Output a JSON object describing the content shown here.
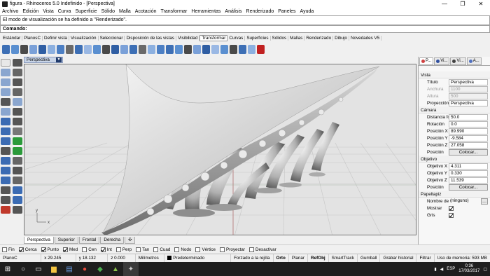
{
  "window": {
    "title": "figura - Rhinoceros 5.0 Indefinido - [Perspectiva]",
    "controls": [
      "—",
      "❐",
      "✕"
    ]
  },
  "menu": [
    "Archivo",
    "Edición",
    "Vista",
    "Curva",
    "Superficie",
    "Sólido",
    "Malla",
    "Acotación",
    "Transformar",
    "Herramientas",
    "Análisis",
    "Renderizado",
    "Paneles",
    "Ayuda"
  ],
  "command": {
    "history": "El modo de visualización se ha definido a \"Renderizado\".",
    "prompt": "Comando:"
  },
  "toolbar_tabs": [
    "Estándar",
    "PlanosC",
    "Definir vista",
    "Visualización",
    "Seleccionar",
    "Disposición de las vistas",
    "Visibilidad",
    "Transformar",
    "Curvas",
    "Superficies",
    "Sólidos",
    "Mallas",
    "Renderizado",
    "Dibujo",
    "Novedades V5"
  ],
  "active_toolbar_tab": "Transformar",
  "viewport": {
    "label": "Perspectiva",
    "axis_y": "y",
    "axis_x": "x"
  },
  "viewport_tabs": [
    "Perspectiva",
    "Superior",
    "Frontal",
    "Derecha"
  ],
  "active_viewport_tab": "Perspectiva",
  "osnaps": [
    {
      "label": "Fin",
      "on": false
    },
    {
      "label": "Cerca",
      "on": true
    },
    {
      "label": "Punto",
      "on": true
    },
    {
      "label": "Med",
      "on": true
    },
    {
      "label": "Cen",
      "on": false
    },
    {
      "label": "Int",
      "on": true
    },
    {
      "label": "Perp",
      "on": false
    },
    {
      "label": "Tan",
      "on": false
    },
    {
      "label": "Cuad",
      "on": false
    },
    {
      "label": "Nodo",
      "on": false
    },
    {
      "label": "Vértice",
      "on": false
    },
    {
      "label": "Proyectar",
      "on": false
    },
    {
      "label": "Desactivar",
      "on": false
    }
  ],
  "status": {
    "cplane": "PlanoC",
    "x": "x 29.245",
    "y": "y 18.132",
    "z": "z 0.000",
    "units": "Milímetros",
    "layer": "Predeterminado",
    "snap": "Forzado a la rejilla",
    "ortho": "Orto",
    "planar": "Planar",
    "osnap": "RefObj",
    "smarttrack": "SmartTrack",
    "gumball": "Gumball",
    "history": "Grabar historial",
    "filter": "Filtrar",
    "memory": "Uso de memoria: 593 MB"
  },
  "panel": {
    "tabs": [
      "P...",
      "Vi...",
      "Vi...",
      "A..."
    ],
    "tab_colors": [
      "#d04040",
      "#3050a0",
      "#404040",
      "#5070c0"
    ],
    "sections": {
      "vista": "Vista",
      "camara": "Cámara",
      "objetivo": "Objetivo",
      "papel": "Papeltapiz"
    },
    "vista_rows": [
      {
        "label": "Título",
        "value": "Perspectiva",
        "disabled": false
      },
      {
        "label": "Anchura",
        "value": "1100",
        "disabled": true
      },
      {
        "label": "Altura",
        "value": "500",
        "disabled": true
      },
      {
        "label": "Proyección",
        "value": "Perspectiva",
        "disabled": false
      }
    ],
    "camara_rows": [
      {
        "label": "Distancia focal",
        "value": "50.0"
      },
      {
        "label": "Rotación",
        "value": "0.0"
      },
      {
        "label": "Posición X",
        "value": "89.990"
      },
      {
        "label": "Posición Y",
        "value": "-9.584"
      },
      {
        "label": "Posición Z",
        "value": "27.058"
      }
    ],
    "camara_btn_label": "Posición",
    "camara_btn": "Colocar...",
    "objetivo_rows": [
      {
        "label": "Objetivo X",
        "value": "4.311"
      },
      {
        "label": "Objetivo Y",
        "value": "0.330"
      },
      {
        "label": "Objetivo Z",
        "value": "11.539"
      }
    ],
    "objetivo_btn_label": "Posición",
    "objetivo_btn": "Colocar...",
    "papel_name_label": "Nombre de ar...",
    "papel_name_value": "(ninguno)",
    "papel_show": "Mostrar",
    "papel_gray": "Gris"
  },
  "taskbar": {
    "lang": "ESP",
    "time": "0:36",
    "date": "17/03/2017"
  }
}
